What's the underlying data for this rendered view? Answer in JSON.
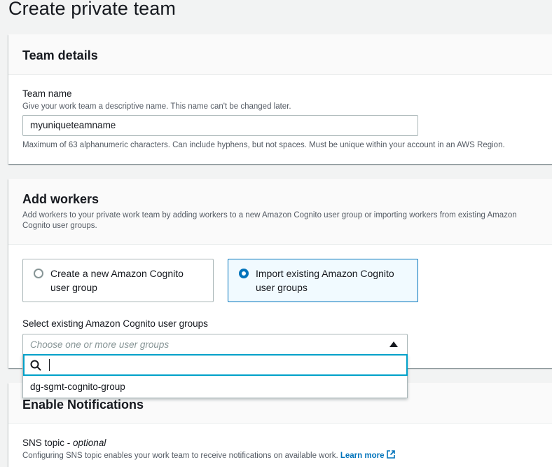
{
  "page": {
    "title": "Create private team"
  },
  "team_details": {
    "title": "Team details",
    "name_label": "Team name",
    "name_description": "Give your work team a descriptive name. This name can't be changed later.",
    "name_value": "myuniqueteamname",
    "name_constraint": "Maximum of 63 alphanumeric characters. Can include hyphens, but not spaces. Must be unique within your account in an AWS Region."
  },
  "add_workers": {
    "title": "Add workers",
    "description_line1": "Add workers to your private work team by adding workers to a new Amazon Cognito user group or importing workers from existing Amazon",
    "description_line2": "Cognito user groups.",
    "options": [
      {
        "line1": "Create a new Amazon Cognito",
        "line2": "user group",
        "selected": false
      },
      {
        "line1": "Import existing Amazon Cognito",
        "line2": "user groups",
        "selected": true
      }
    ],
    "select_label": "Select existing Amazon Cognito user groups",
    "select_placeholder": "Choose one or more user groups",
    "filter_value": "",
    "dropdown_options": [
      "dg-sgmt-cognito-group"
    ]
  },
  "notifications": {
    "title": "Enable Notifications",
    "sns_label": "SNS topic",
    "sns_optional": "optional",
    "sns_description": "Configuring SNS topic enables your work team to receive notifications on available work.",
    "learn_more": "Learn more"
  },
  "colors": {
    "accent": "#0073bb",
    "focus": "#00a1c9",
    "page_bg": "#f2f3f3"
  }
}
